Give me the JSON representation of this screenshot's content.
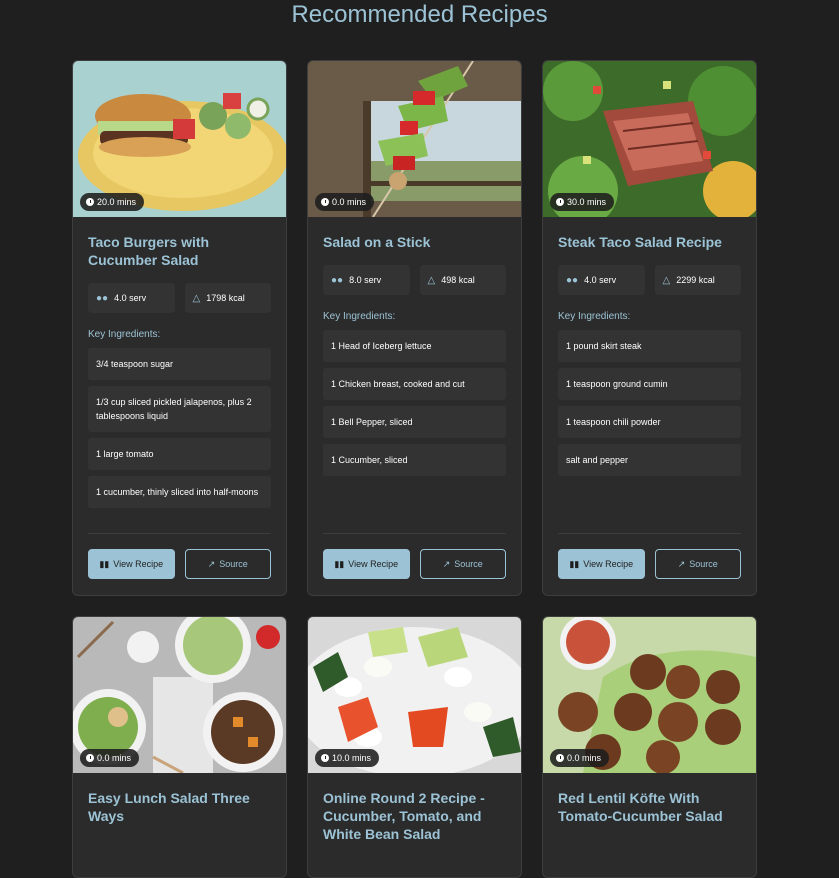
{
  "page_title": "Recommended Recipes",
  "labels": {
    "key_ingredients": "Key Ingredients:",
    "view_recipe": "View Recipe",
    "source": "Source"
  },
  "icons": {
    "clock": "clock-icon",
    "servings": "users-icon",
    "calories": "fire-icon",
    "view": "book-open-icon",
    "source": "external-link-icon"
  },
  "colors": {
    "accent": "#9cc3d5",
    "background": "#1f1f1f",
    "card": "#2b2b2b"
  },
  "recipes": [
    {
      "time": "20.0 mins",
      "title": "Taco Burgers with Cucumber Salad",
      "servings": "4.0 serv",
      "calories": "1798 kcal",
      "ingredients": [
        "3/4 teaspoon sugar",
        "1/3 cup sliced pickled jalapenos, plus 2 tablespoons liquid",
        "1 large tomato",
        "1 cucumber, thinly sliced into half-moons"
      ]
    },
    {
      "time": "0.0 mins",
      "title": "Salad on a Stick",
      "servings": "8.0 serv",
      "calories": "498 kcal",
      "ingredients": [
        "1 Head of Iceberg lettuce",
        "1 Chicken breast, cooked and cut",
        "1 Bell Pepper, sliced",
        "1 Cucumber, sliced"
      ]
    },
    {
      "time": "30.0 mins",
      "title": "Steak Taco Salad Recipe",
      "servings": "4.0 serv",
      "calories": "2299 kcal",
      "ingredients": [
        "1 pound skirt steak",
        "1 teaspoon ground cumin",
        "1 teaspoon chili powder",
        "salt and pepper"
      ]
    },
    {
      "time": "0.0 mins",
      "title": "Easy Lunch Salad Three Ways"
    },
    {
      "time": "10.0 mins",
      "title": "Online Round 2 Recipe - Cucumber, Tomato, and White Bean Salad"
    },
    {
      "time": "0.0 mins",
      "title": "Red Lentil Köfte With Tomato-Cucumber Salad"
    }
  ]
}
